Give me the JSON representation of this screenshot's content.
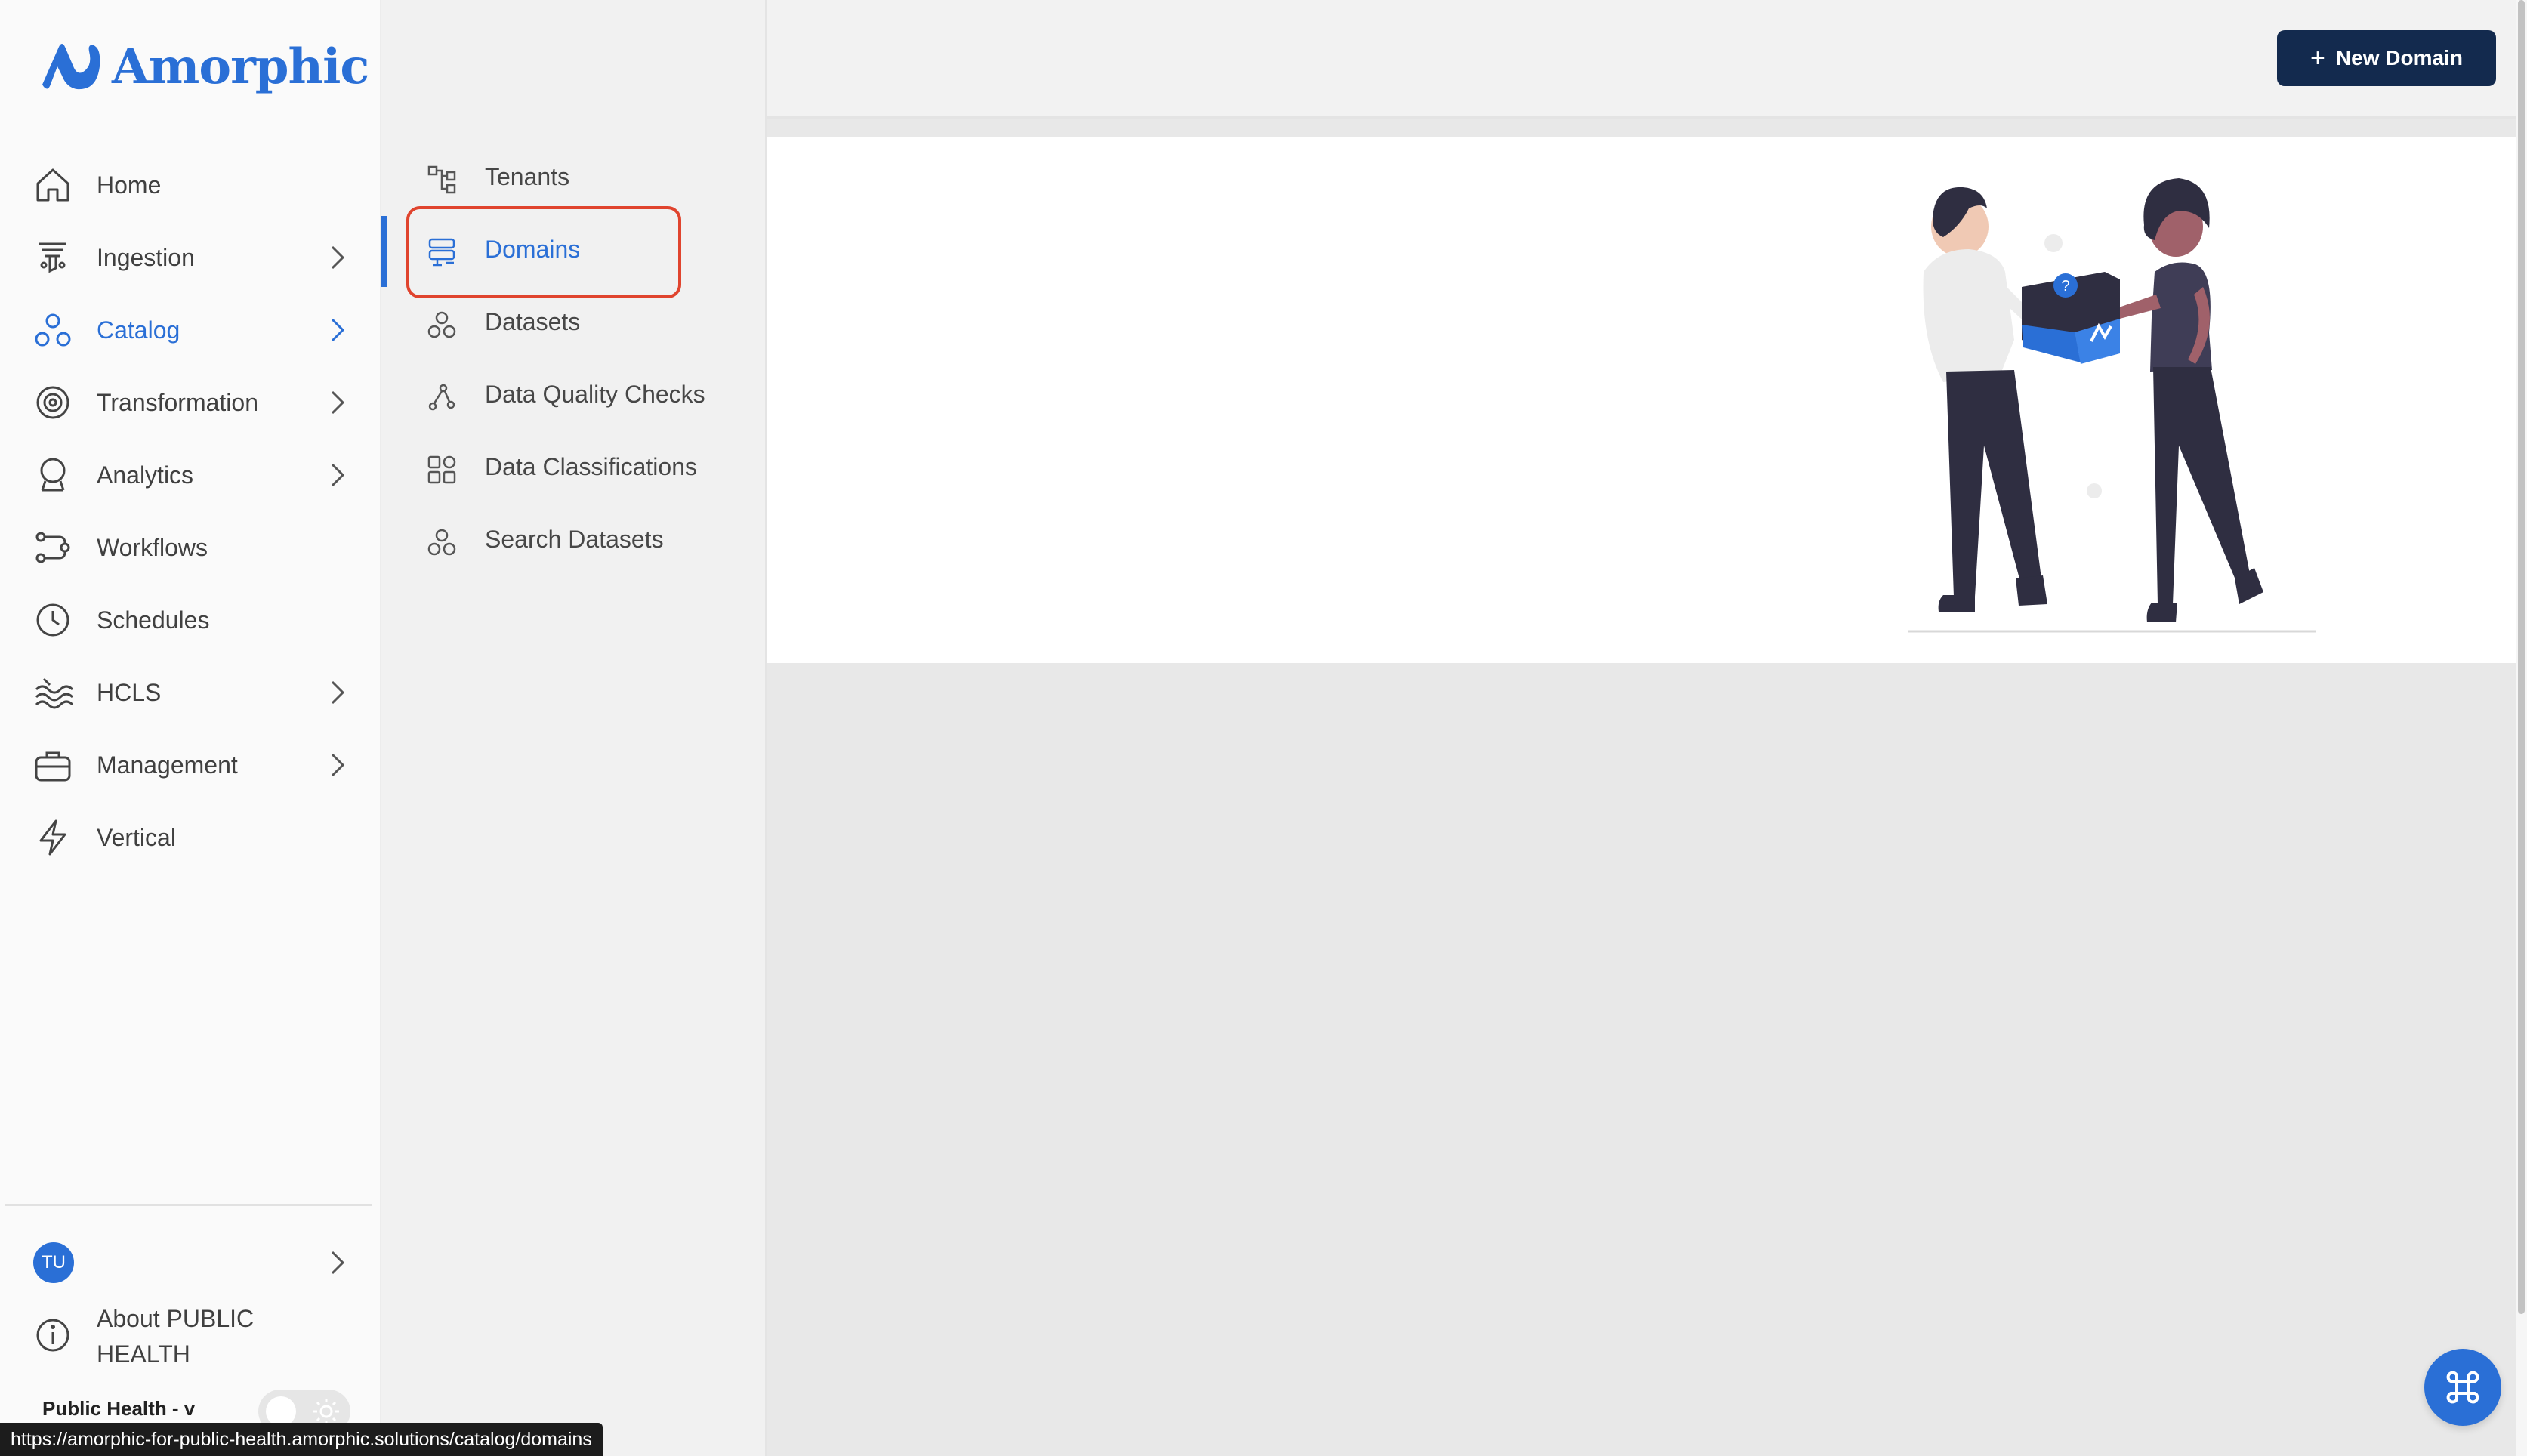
{
  "app": {
    "name": "Amorphic",
    "brand_color": "#2a6fd6"
  },
  "nav": {
    "items": [
      {
        "label": "Home",
        "icon": "home-icon",
        "has_submenu": false,
        "active": false
      },
      {
        "label": "Ingestion",
        "icon": "funnel-icon",
        "has_submenu": true,
        "active": false
      },
      {
        "label": "Catalog",
        "icon": "catalog-icon",
        "has_submenu": true,
        "active": true
      },
      {
        "label": "Transformation",
        "icon": "transformation-icon",
        "has_submenu": true,
        "active": false
      },
      {
        "label": "Analytics",
        "icon": "analytics-icon",
        "has_submenu": true,
        "active": false
      },
      {
        "label": "Workflows",
        "icon": "workflows-icon",
        "has_submenu": false,
        "active": false
      },
      {
        "label": "Schedules",
        "icon": "clock-icon",
        "has_submenu": false,
        "active": false
      },
      {
        "label": "HCLS",
        "icon": "waves-icon",
        "has_submenu": true,
        "active": false
      },
      {
        "label": "Management",
        "icon": "briefcase-icon",
        "has_submenu": true,
        "active": false
      },
      {
        "label": "Vertical",
        "icon": "lightning-icon",
        "has_submenu": false,
        "active": false
      }
    ]
  },
  "user": {
    "initials": "TU"
  },
  "about": {
    "label": "About PUBLIC HEALTH"
  },
  "tenant": {
    "label": "Public Health - v"
  },
  "submenu": {
    "items": [
      {
        "label": "Tenants",
        "icon": "tenants-icon",
        "active": false
      },
      {
        "label": "Domains",
        "icon": "domains-icon",
        "active": true
      },
      {
        "label": "Datasets",
        "icon": "datasets-icon",
        "active": false
      },
      {
        "label": "Data Quality Checks",
        "icon": "data-quality-icon",
        "active": false
      },
      {
        "label": "Data Classifications",
        "icon": "classifications-icon",
        "active": false
      },
      {
        "label": "Search Datasets",
        "icon": "search-datasets-icon",
        "active": false
      }
    ]
  },
  "toolbar": {
    "new_domain_label": "New Domain",
    "button_color": "#132a4e"
  },
  "status_bar": {
    "url": "https://amorphic-for-public-health.amorphic.solutions/catalog/domains"
  }
}
